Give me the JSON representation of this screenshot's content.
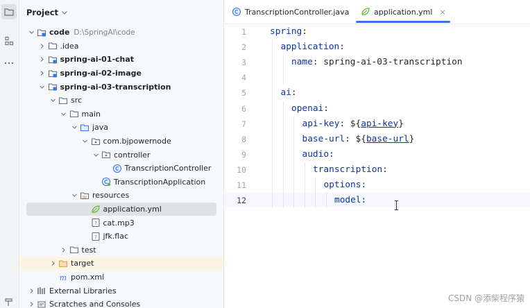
{
  "project_panel": {
    "title": "Project",
    "tree": [
      {
        "label": "code",
        "hint": "D:\\SpringAI\\code",
        "bold": true,
        "indent": 0,
        "twisty": "open",
        "icon": "module-folder"
      },
      {
        "label": ".idea",
        "bold": false,
        "indent": 1,
        "twisty": "closed",
        "icon": "folder"
      },
      {
        "label": "spring-ai-01-chat",
        "bold": true,
        "indent": 1,
        "twisty": "closed",
        "icon": "module-folder"
      },
      {
        "label": "spring-ai-02-image",
        "bold": true,
        "indent": 1,
        "twisty": "closed",
        "icon": "module-folder"
      },
      {
        "label": "spring-ai-03-transcription",
        "bold": true,
        "indent": 1,
        "twisty": "open",
        "icon": "module-folder"
      },
      {
        "label": "src",
        "bold": false,
        "indent": 2,
        "twisty": "open",
        "icon": "folder"
      },
      {
        "label": "main",
        "bold": false,
        "indent": 3,
        "twisty": "open",
        "icon": "folder"
      },
      {
        "label": "java",
        "bold": false,
        "indent": 4,
        "twisty": "open",
        "icon": "source-folder"
      },
      {
        "label": "com.bjpowernode",
        "bold": false,
        "indent": 5,
        "twisty": "open",
        "icon": "package"
      },
      {
        "label": "controller",
        "bold": false,
        "indent": 6,
        "twisty": "open",
        "icon": "package"
      },
      {
        "label": "TranscriptionController",
        "bold": false,
        "indent": 7,
        "twisty": "none",
        "icon": "class"
      },
      {
        "label": "TranscriptionApplication",
        "bold": false,
        "indent": 6,
        "twisty": "none",
        "icon": "spring-class"
      },
      {
        "label": "resources",
        "bold": false,
        "indent": 4,
        "twisty": "open",
        "icon": "resources-folder"
      },
      {
        "label": "application.yml",
        "bold": false,
        "indent": 5,
        "twisty": "none",
        "icon": "yaml",
        "selected": true
      },
      {
        "label": "cat.mp3",
        "bold": false,
        "indent": 5,
        "twisty": "none",
        "icon": "unknown-file"
      },
      {
        "label": "jfk.flac",
        "bold": false,
        "indent": 5,
        "twisty": "none",
        "icon": "unknown-file"
      },
      {
        "label": "test",
        "bold": false,
        "indent": 3,
        "twisty": "closed",
        "icon": "folder"
      },
      {
        "label": "target",
        "bold": false,
        "indent": 2,
        "twisty": "closed",
        "icon": "excluded-folder",
        "excluded": true
      },
      {
        "label": "pom.xml",
        "bold": false,
        "indent": 2,
        "twisty": "none",
        "icon": "maven"
      },
      {
        "label": "External Libraries",
        "bold": false,
        "indent": 0,
        "twisty": "closed",
        "icon": "libraries"
      },
      {
        "label": "Scratches and Consoles",
        "bold": false,
        "indent": 0,
        "twisty": "closed",
        "icon": "scratches"
      }
    ]
  },
  "editor": {
    "tabs": [
      {
        "label": "TranscriptionController.java",
        "icon": "class",
        "active": false
      },
      {
        "label": "application.yml",
        "icon": "yaml",
        "active": true,
        "close": "×"
      }
    ],
    "current_line": 12,
    "lines": [
      {
        "n": "1",
        "indent": 0,
        "parts": [
          {
            "t": "spring",
            "c": "key"
          },
          {
            "t": ":"
          }
        ]
      },
      {
        "n": "2",
        "indent": 1,
        "parts": [
          {
            "t": "application",
            "c": "key"
          },
          {
            "t": ":"
          }
        ]
      },
      {
        "n": "3",
        "indent": 2,
        "parts": [
          {
            "t": "name",
            "c": "key"
          },
          {
            "t": ": spring-ai-03-transcription"
          }
        ]
      },
      {
        "n": "4",
        "indent": 0,
        "parts": []
      },
      {
        "n": "5",
        "indent": 1,
        "parts": [
          {
            "t": "ai",
            "c": "key"
          },
          {
            "t": ":"
          }
        ]
      },
      {
        "n": "6",
        "indent": 2,
        "parts": [
          {
            "t": "openai",
            "c": "key"
          },
          {
            "t": ":"
          }
        ]
      },
      {
        "n": "7",
        "indent": 3,
        "parts": [
          {
            "t": "api-key",
            "c": "key"
          },
          {
            "t": ": ${"
          },
          {
            "t": "api-key",
            "c": "link"
          },
          {
            "t": "}"
          }
        ]
      },
      {
        "n": "8",
        "indent": 3,
        "parts": [
          {
            "t": "base-url",
            "c": "key"
          },
          {
            "t": ": ${"
          },
          {
            "t": "base-url",
            "c": "link"
          },
          {
            "t": "}"
          }
        ]
      },
      {
        "n": "9",
        "indent": 3,
        "parts": [
          {
            "t": "audio",
            "c": "key"
          },
          {
            "t": ":"
          }
        ]
      },
      {
        "n": "10",
        "indent": 4,
        "parts": [
          {
            "t": "transcription",
            "c": "key"
          },
          {
            "t": ":"
          }
        ]
      },
      {
        "n": "11",
        "indent": 5,
        "parts": [
          {
            "t": "options",
            "c": "key"
          },
          {
            "t": ":"
          }
        ]
      },
      {
        "n": "12",
        "indent": 6,
        "parts": [
          {
            "t": "model",
            "c": "key"
          },
          {
            "t": ":"
          }
        ]
      }
    ]
  },
  "watermark": "CSDN @添柴程序猿",
  "colors": {
    "accent": "#3574f0",
    "yaml_key": "#0b33a9",
    "selection": "#dfe1e6",
    "excluded_bg": "#fdf5e3"
  }
}
